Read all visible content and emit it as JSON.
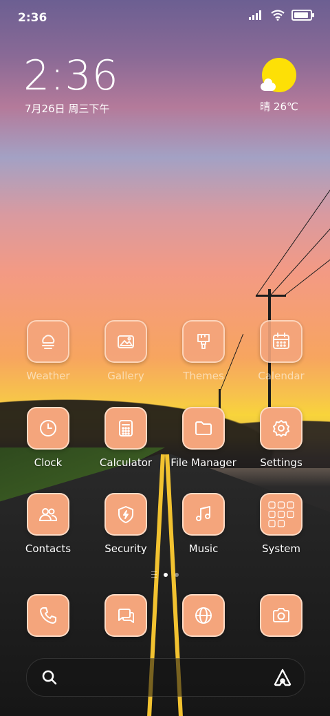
{
  "status_bar": {
    "time": "2:36"
  },
  "clock_widget": {
    "time": "2:36",
    "date": "7月26日 周三下午"
  },
  "weather_widget": {
    "text": "晴 26℃"
  },
  "apps_row1": [
    {
      "label": "Weather",
      "icon": "weather-icon"
    },
    {
      "label": "Gallery",
      "icon": "gallery-icon"
    },
    {
      "label": "Themes",
      "icon": "themes-icon"
    },
    {
      "label": "Calendar",
      "icon": "calendar-icon"
    }
  ],
  "apps_row2": [
    {
      "label": "Clock",
      "icon": "clock-icon"
    },
    {
      "label": "Calculator",
      "icon": "calculator-icon"
    },
    {
      "label": "File Manager",
      "icon": "folder-icon"
    },
    {
      "label": "Settings",
      "icon": "gear-icon"
    }
  ],
  "apps_row3": [
    {
      "label": "Contacts",
      "icon": "contacts-icon"
    },
    {
      "label": "Security",
      "icon": "shield-icon"
    },
    {
      "label": "Music",
      "icon": "music-note-icon"
    },
    {
      "label": "System",
      "icon": "app-folder-icon"
    }
  ],
  "dock": [
    {
      "icon": "phone-icon"
    },
    {
      "icon": "messages-icon"
    },
    {
      "icon": "browser-icon"
    },
    {
      "icon": "camera-icon"
    }
  ],
  "pages": {
    "count": 2,
    "active": 1
  },
  "battery_level": 0.9,
  "colors": {
    "tile": "#f4a57c",
    "sun": "#fde006"
  }
}
